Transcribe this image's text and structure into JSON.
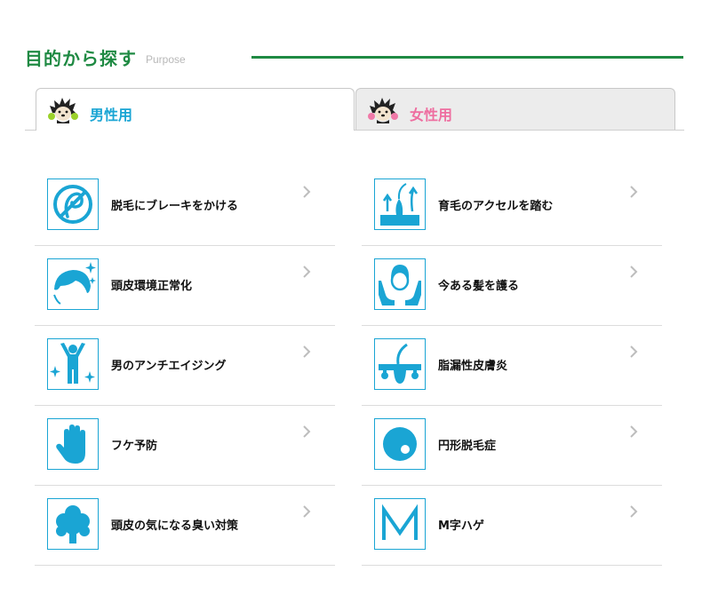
{
  "header": {
    "title": "目的から探す",
    "subtitle": "Purpose"
  },
  "tabs": [
    {
      "label": "男性用",
      "active": true
    },
    {
      "label": "女性用",
      "active": false
    }
  ],
  "colors": {
    "brand_green": "#1f8a43",
    "accent_blue": "#1aa5d4",
    "female_pink": "#ee6ea0"
  },
  "menu": {
    "left": [
      {
        "label": "脱毛にブレーキをかける",
        "icon": "no-hair-loss-icon"
      },
      {
        "label": "頭皮環境正常化",
        "icon": "hair-sparkle-icon"
      },
      {
        "label": "男のアンチエイジング",
        "icon": "man-energy-icon"
      },
      {
        "label": "フケ予防",
        "icon": "hand-icon"
      },
      {
        "label": "頭皮の気になる臭い対策",
        "icon": "odor-cloud-icon"
      }
    ],
    "right": [
      {
        "label": "育毛のアクセルを踏む",
        "icon": "hair-growth-icon"
      },
      {
        "label": "今ある髪を護る",
        "icon": "protect-hair-icon"
      },
      {
        "label": "脂漏性皮膚炎",
        "icon": "follicle-icon"
      },
      {
        "label": "円形脱毛症",
        "icon": "alopecia-areata-icon"
      },
      {
        "label": "M字ハゲ",
        "icon": "m-shape-icon"
      }
    ]
  }
}
